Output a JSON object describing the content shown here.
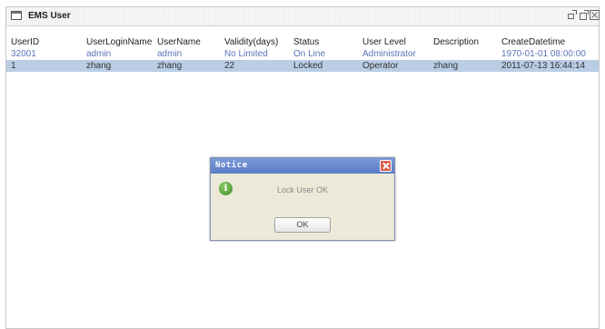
{
  "window": {
    "title": "EMS User",
    "icon": "window-icon",
    "controls": [
      "minimize-icon",
      "maximize-icon",
      "close-icon"
    ]
  },
  "table": {
    "columns": [
      "UserID",
      "UserLoginName",
      "UserName",
      "Validity(days)",
      "Status",
      "User Level",
      "Description",
      "CreateDatetime"
    ],
    "rows": [
      [
        "32001",
        "admin",
        "admin",
        "No Limited",
        "On Line",
        "Administrator",
        "",
        "1970-01-01 08:00:00"
      ],
      [
        "1",
        "zhang",
        "zhang",
        "22",
        "Locked",
        "Operator",
        "zhang",
        "2011-07-13 16:44:14"
      ]
    ],
    "selected_row": 1
  },
  "dialog": {
    "title": "Notice",
    "icon": "info-icon",
    "message": "Lock User OK",
    "ok_label": "OK"
  },
  "colors": {
    "selected_row_bg": "#b9cde5",
    "link_text": "#5a74b8",
    "dialog_title_bar": "#6a8bd0",
    "dialog_close": "#d95a4a"
  }
}
